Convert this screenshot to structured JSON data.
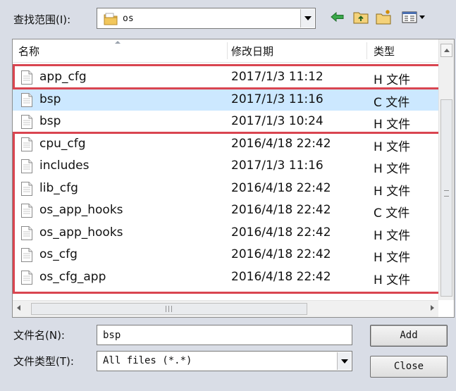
{
  "lookin": {
    "label": "查找范围(I):",
    "value": "os"
  },
  "toolbar": {
    "back_icon": "back-arrow-icon",
    "up_icon": "folder-up-icon",
    "new_icon": "new-folder-icon",
    "view_icon": "view-menu-icon"
  },
  "list": {
    "headers": {
      "name": "名称",
      "date": "修改日期",
      "type": "类型"
    },
    "rows": [
      {
        "name": "app_cfg",
        "date": "2017/1/3 11:12",
        "type": "H 文件",
        "selected": false
      },
      {
        "name": "bsp",
        "date": "2017/1/3 11:16",
        "type": "C 文件",
        "selected": true
      },
      {
        "name": "bsp",
        "date": "2017/1/3 10:24",
        "type": "H 文件",
        "selected": false
      },
      {
        "name": "cpu_cfg",
        "date": "2016/4/18 22:42",
        "type": "H 文件",
        "selected": false
      },
      {
        "name": "includes",
        "date": "2017/1/3 11:16",
        "type": "H 文件",
        "selected": false
      },
      {
        "name": "lib_cfg",
        "date": "2016/4/18 22:42",
        "type": "H 文件",
        "selected": false
      },
      {
        "name": "os_app_hooks",
        "date": "2016/4/18 22:42",
        "type": "C 文件",
        "selected": false
      },
      {
        "name": "os_app_hooks",
        "date": "2016/4/18 22:42",
        "type": "H 文件",
        "selected": false
      },
      {
        "name": "os_cfg",
        "date": "2016/4/18 22:42",
        "type": "H 文件",
        "selected": false
      },
      {
        "name": "os_cfg_app",
        "date": "2016/4/18 22:42",
        "type": "H 文件",
        "selected": false
      }
    ]
  },
  "filename": {
    "label": "文件名(N):",
    "value": "bsp"
  },
  "filetype": {
    "label": "文件类型(T):",
    "value": "All files (*.*)"
  },
  "buttons": {
    "add": "Add",
    "close": "Close"
  },
  "colors": {
    "selection": "#cce8ff",
    "highlight_box": "#d94550",
    "folder": "#e8b84a"
  }
}
